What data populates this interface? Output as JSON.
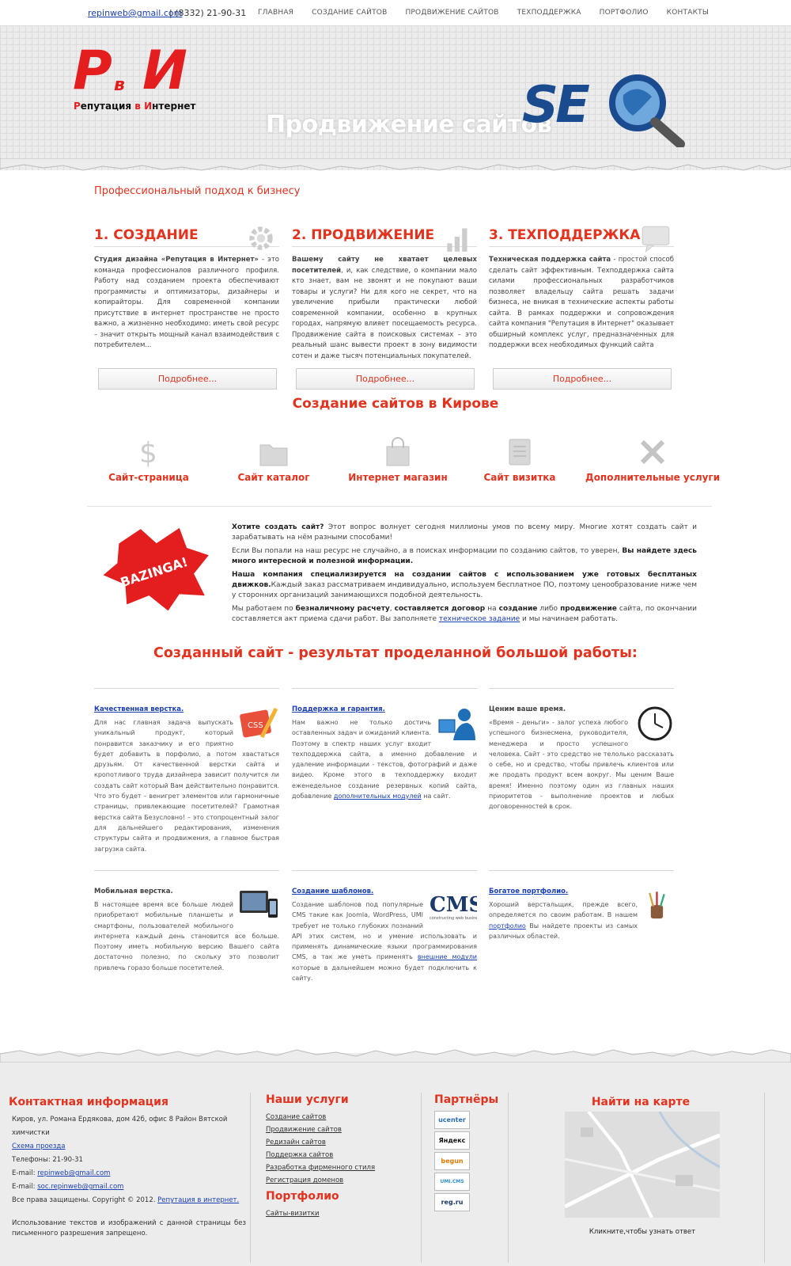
{
  "topbar": {
    "email": "repinweb@gmail.com",
    "phone": "| (8332) 21-90-31",
    "nav": [
      "ГЛАВНАЯ",
      "СОЗДАНИЕ САЙТОВ",
      "ПРОДВИЖЕНИЕ САЙТОВ",
      "ТЕХПОДДЕРЖКА",
      "ПОРТФОЛИО",
      "КОНТАКТЫ"
    ]
  },
  "header": {
    "logo_letters": "РвИ",
    "logo_sub_1": "Р",
    "logo_sub_2": "епутация ",
    "logo_sub_3": "в",
    "logo_sub_4": " И",
    "logo_sub_5": "нтернет",
    "title": "Продвижение сайтов",
    "seo_text": "SEO"
  },
  "tagline": "Профессиональный подход к бизнесу",
  "columns": [
    {
      "title": "1. СОЗДАНИЕ",
      "icon": "gear-icon",
      "lead": "Студия дизайна «Репутация в Интернет»",
      "text": " - это команда профессионалов различного профиля. Работу над созданием проекта обеспечивают программисты и оптимизаторы, дизайнеры и копирайторы. Для современной компании присутствие в интернет пространстве не просто важно, а жизненно необходимо: иметь свой ресурс – значит открыть мощный канал взаимодействия с потребителем...",
      "button": "Подробнее..."
    },
    {
      "title": "2. ПРОДВИЖЕНИЕ",
      "icon": "bar-chart-icon",
      "lead": "Вашему сайту не хватает целевых посетителей",
      "text": ", и, как следствие, о компании мало кто знает, вам не звонят и не покупают ваши товары и услуги? Ни для кого не секрет, что на увеличение прибыли практически любой современной компании, особенно в крупных городах, напрямую влияет посещаемость ресурса. Продвижение сайта в поисковых системах – это реальный шанс вывести проект в зону видимости сотен и даже тысяч потенциальных покупателей.",
      "button": "Подробнее..."
    },
    {
      "title": "3. ТЕХПОДДЕРЖКА",
      "icon": "speech-bubble-icon",
      "lead": "Техническая поддержка сайта",
      "text": " - простой способ сделать сайт эффективным. Техподдержка сайта силами профессиональных разработчиков позволяет владельцу сайта решать задачи бизнеса, не вникая в технические аспекты работы сайта. В рамках поддержки и сопровождения сайта компания \"Репутация в Интернет\" оказывает обширный комплекс услуг, предназначенных для поддержки всех необходимых функций сайта",
      "button": "Подробнее..."
    }
  ],
  "services_title": "Создание сайтов в Кирове",
  "services": [
    {
      "label": "Сайт-страница",
      "icon": "dollar-icon"
    },
    {
      "label": "Сайт каталог",
      "icon": "folder-icon"
    },
    {
      "label": "Интернет магазин",
      "icon": "shopping-bag-icon"
    },
    {
      "label": "Сайт визитка",
      "icon": "notepad-icon"
    },
    {
      "label": "Дополнительные услуги",
      "icon": "tools-icon"
    }
  ],
  "bazinga": "BAZINGA!",
  "intro": {
    "p1_b": "Хотите создать сайт?",
    "p1": " Этот вопрос волнует сегодня миллионы умов по всему миру. Многие хотят создать сайт и зарабатывать на нём разными способами!",
    "p2": "Если Вы попали на наш ресурс не случайно, а в поисках информации по созданию сайтов, то уверен, ",
    "p2_b": "Вы найдете здесь много интересной и полезной информации.",
    "p3_b": "Наша компания специализируется на создании сайтов с использованием уже готовых бесплтаных движков.",
    "p3": "Каждый заказ рассматриваем индивидуально, используем бесплатное ПО, поэтому ценообразование ниже чем у сторонних организаций занимающихся подобной деятельность.",
    "p4_a": "Мы работаем по ",
    "p4_b1": "безналичному расчету",
    "p4_c": ", ",
    "p4_b2": "составляется договор",
    "p4_d": " на ",
    "p4_b3": "создание",
    "p4_e": " либо ",
    "p4_b4": "продвижение",
    "p4_f": " сайта, по окончании составляется акт приема сдачи работ. Вы заполняете ",
    "p4_link": "техническое задание",
    "p4_g": " и мы начинаем работать."
  },
  "result_title": "Созданный сайт - результат проделанной большой работы:",
  "features": [
    {
      "title": "Качественная верстка.",
      "link": true,
      "icon": "css-pencil-icon",
      "text": "Для нас главная задача выпускать уникальный продукт, который понравится заказчику и его приятно будет добавить в порфолио, а потом хвастаться друзьям. От качественной верстки сайта и кропотливого труда дизайнера зависит получится ли создать сайт который Вам действительно понравится. Что это будет – венигрет элементов или гармоничные страницы, привлекающие посетителей? Грамотная верстка сайта Безусловно! – это стопроцентный залог для дальнейшего редактирования, изменения структуры сайта и продвижения, а главное быстрая загрузка сайта."
    },
    {
      "title": "Поддержка и гарантия.",
      "link": true,
      "icon": "support-person-icon",
      "text": "Нам важно не только достичь оставленных задач и ожиданий клиента. Поэтому в спектр наших услуг входит техподдержка сайта, а именно добавление и удаление информации - текстов, фотографий и даже видео. Кроме этого в техподдержку входит еженедельное создание резервных копий сайта, добавление ",
      "link_text": "дополнительных модулей",
      "tail": " на сайт."
    },
    {
      "title": "Ценим ваше время.",
      "link": false,
      "icon": "clock-icon",
      "text": "«Время – деньги» - залог успеха любого успешного бизнесмена, руководителя, менеджера и просто успешного человека. Сайт - это средство не телолько рассказать о себе, но и средство, чтобы привлечь клиентов или же продать продукт всем вокруг. Мы ценим Ваше время! Именно поэтому один из главных наших приоритетов - выполнение проектов и любых договоренностей в срок."
    },
    {
      "title": "Мобильная верстка.",
      "link": false,
      "icon": "mobile-devices-icon",
      "text": "В настоящее время все больше людей приобретают мобильные планшеты и смартфоны, пользователей мобильного интернета каждый день становится все больше. Поэтому иметь мобильную версию Вашего сайта достаточно полезно, по скольку это позволит привлечь горазо больше посетителей."
    },
    {
      "title": "Создание шаблонов.",
      "link": true,
      "icon": "cms-logo-icon",
      "text": "Создание шаблонов под популярные CMS такие как Joomla, WordPress, UMI требует не только глубоких познаний API этих систем, но и умение использовать и применять динамические языки программирования CMS, а так же уметь применять ",
      "link_text": "внешние модули",
      "tail": " которые в дальнейшем можно будет подключить к сайту."
    },
    {
      "title": "Богатое портфолио.",
      "link": true,
      "icon": "brushes-icon",
      "text": "Хороший верстальщик, прежде всего, определяется по своим работам. В нашем ",
      "link_text": "портфолио",
      "tail": " Вы найдете проекты из самых различных областей."
    }
  ],
  "footer": {
    "contacts_title": "Контактная информация",
    "address": "Киров, ул. Романа Ердякова, дом 42б, офис 8 Район Вятской химчистки",
    "map_link": "Схема проезда",
    "phones": "Телефоны: 21-90-31",
    "email1_label": "E-mail: ",
    "email1": "repinweb@gmail.com",
    "email2_label": "E-mail: ",
    "email2": "soc.repinweb@gmail.com",
    "copyright": "Все права защищены. Copyright © 2012. ",
    "copyright_link": "Репутация в интернет.",
    "disclaimer": "Использование текстов и изображений с данной страницы без письменного разрешения запрещено.",
    "services_title": "Наши услуги",
    "services": [
      "Создание сайтов",
      "Продвижение сайтов",
      "Редизайн сайтов",
      "Поддержка сайтов",
      "Разработка фирменного стиля",
      "Регистрация доменов"
    ],
    "portfolio_title": "Портфолио",
    "portfolio": [
      "Сайты-визитки"
    ],
    "partners_title": "Партнёры",
    "partners": [
      "ucenter",
      "Яндекс",
      "begun",
      "UMI.CMS",
      "reg.ru"
    ],
    "map_title": "Найти на карте",
    "map_caption": "Кликните,чтобы узнать ответ"
  }
}
